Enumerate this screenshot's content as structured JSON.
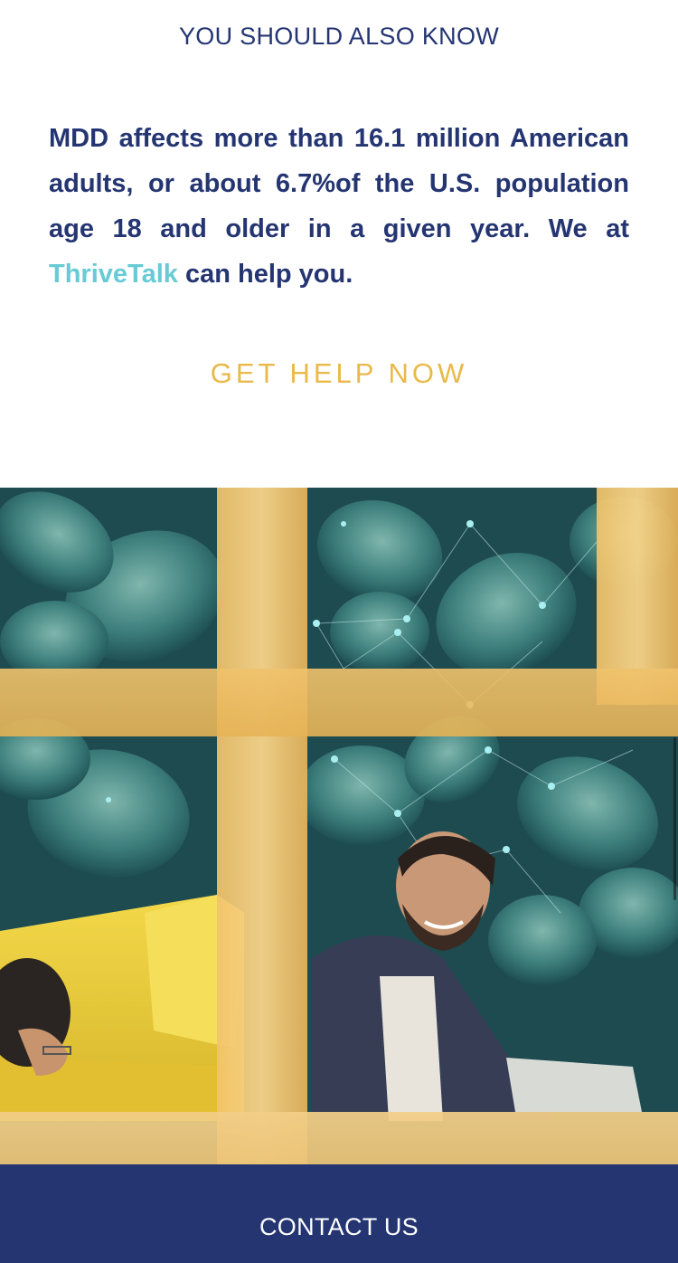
{
  "section": {
    "heading": "YOU SHOULD ALSO KNOW"
  },
  "fact": {
    "text_before": "MDD affects more than 16.1 million American adults, or about 6.7%of the U.S. population age 18 and older in a given year. We at ",
    "brand": "ThriveTalk",
    "text_after": " can help you."
  },
  "cta": {
    "label": "GET HELP NOW"
  },
  "footer": {
    "contact_label": "CONTACT US"
  },
  "colors": {
    "navy": "#243571",
    "teal_brand": "#67cbd6",
    "gold_cta": "#e9b949",
    "footer_bg": "#243571"
  }
}
